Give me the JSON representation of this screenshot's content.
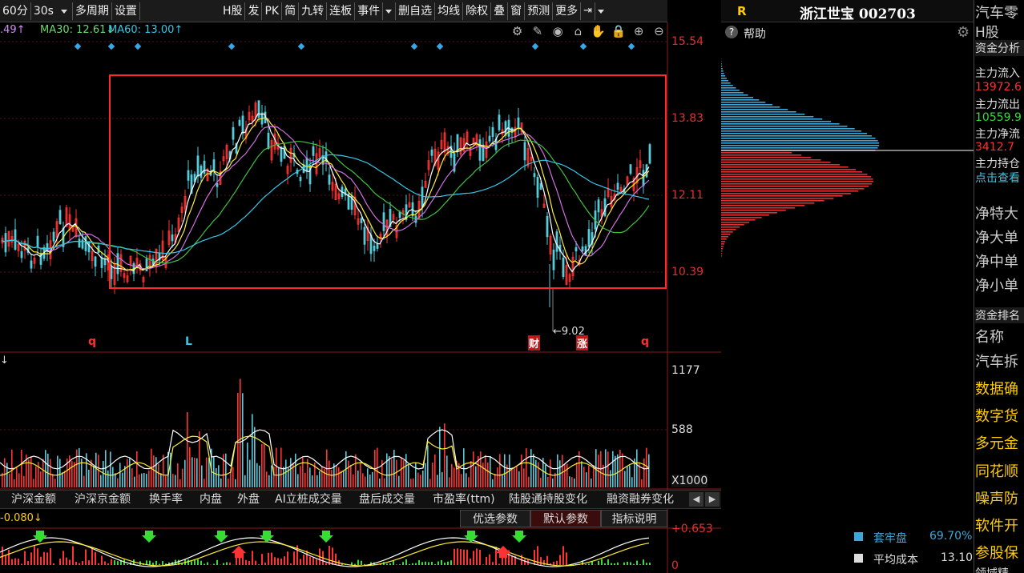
{
  "toolbar": {
    "period": "60分",
    "interval": "30s",
    "multi": "多周期",
    "settings": "设置",
    "hstock": "H股",
    "fa": "发",
    "pk": "PK",
    "jian": "简",
    "jiuzhuan": "九转",
    "lianban": "连板",
    "shijian": "事件",
    "delete_self": "删自选",
    "junxian": "均线",
    "chuquan": "除权",
    "die": "叠",
    "chuang": "窗",
    "yuce": "预测",
    "more": "更多"
  },
  "ma": {
    "ma_prefix": ".49↑",
    "ma30": "MA30: 12.61↓",
    "ma60": "MA60: 13.00↑"
  },
  "price_axis": [
    "15.54",
    "13.83",
    "12.11",
    "10.39"
  ],
  "low_label": "←9.02",
  "bottom_markers": {
    "q1": "q",
    "l": "L",
    "cai": "财",
    "zhang": "涨",
    "q2": "q"
  },
  "vol": {
    "top_label": "↓",
    "ticks": [
      "1177",
      "588"
    ],
    "unit": "X1000"
  },
  "tabs": [
    "沪深金额",
    "沪深京金额",
    "换手率",
    "内盘",
    "外盘",
    "AI立桩成交量",
    "盘后成交量",
    "市盈率(ttm)",
    "陆股通持股变化",
    "融资融券变化"
  ],
  "param": {
    "value": "-0.080↓",
    "opt": "优选参数",
    "def": "默认参数",
    "expl": "指标说明",
    "ticks": [
      "+0.653",
      "0"
    ]
  },
  "right": {
    "r": "R",
    "title": "浙江世宝 002703",
    "help": "帮助",
    "tao": "套牢盘",
    "tao_v": "69.70%",
    "avg": "平均成本",
    "avg_v": "13.10"
  },
  "side": {
    "s1": "汽车零",
    "s2": "H股",
    "s3": "资金分析",
    "s4": "主力流入",
    "s5": "13972.6",
    "s6": "主力流出",
    "s7": "10559.9",
    "s8": "主力净流",
    "s9": "3412.7",
    "s10": "主力持仓",
    "s11": "点击查看",
    "s12": "净特大",
    "s13": "净大单",
    "s14": "净中单",
    "s15": "净小单",
    "s16": "资金排名",
    "s17": "名称",
    "s18": "汽车拆",
    "s19": "数据确",
    "s20": "数字货",
    "s21": "多元金",
    "s22": "同花顺",
    "s23": "噪声防",
    "s24": "软件开",
    "s25": "参股保",
    "s26": "领域精"
  },
  "colors": {
    "up": "#ff3333",
    "down": "#55ccdd",
    "accent": "#ffcc00"
  }
}
